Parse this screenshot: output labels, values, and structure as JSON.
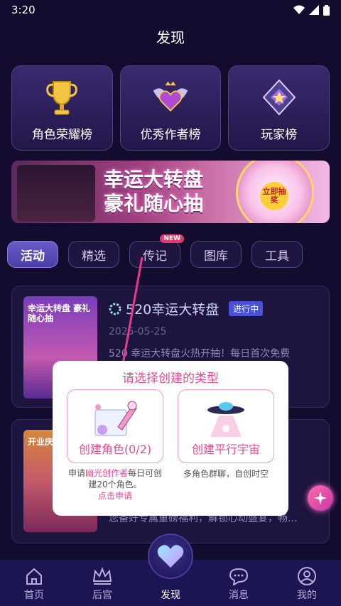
{
  "status_bar": {
    "time": "3:20"
  },
  "header": {
    "title": "发现"
  },
  "top_cards": [
    {
      "label": "角色荣耀榜",
      "icon": "trophy-icon"
    },
    {
      "label": "优秀作者榜",
      "icon": "winged-heart-badge-icon"
    },
    {
      "label": "玩家榜",
      "icon": "diamond-badge-icon"
    }
  ],
  "banner": {
    "title_line1": "幸运大转盘",
    "title_line2": "豪礼随心抽",
    "wheel_button": "立即抽奖"
  },
  "tabs": [
    {
      "label": "活动",
      "active": true
    },
    {
      "label": "精选"
    },
    {
      "label": "传记",
      "badge": "NEW"
    },
    {
      "label": "图库"
    },
    {
      "label": "工具"
    }
  ],
  "feed": [
    {
      "thumb_text": "幸运大转盘 豪礼随心抽",
      "title": "520幸运大转盘",
      "status": "进行中",
      "date": "2025-05-25",
      "description": "520 幸运大转盘火热开抽！每日首次免费"
    },
    {
      "thumb_text": "开业庆典",
      "description": "您备好专属重磅福利，解锁心动盛宴，畅..."
    }
  ],
  "modal": {
    "title": "请选择创建的类型",
    "option1": "创建角色(0/2)",
    "option2": "创建平行宇宙",
    "hint1_prefix": "申请",
    "hint1_highlight": "幽光创作者",
    "hint1_suffix": "每日可创建20个角色。",
    "hint1_link": "点击申请",
    "hint2": "多角色群聊，自创时空"
  },
  "bottom_nav": [
    {
      "label": "首页",
      "icon": "home-icon"
    },
    {
      "label": "后宫",
      "icon": "crown-icon"
    },
    {
      "label": "发现",
      "icon": "heart-icon"
    },
    {
      "label": "消息",
      "icon": "chat-bubble-icon"
    },
    {
      "label": "我的",
      "icon": "user-icon"
    }
  ]
}
